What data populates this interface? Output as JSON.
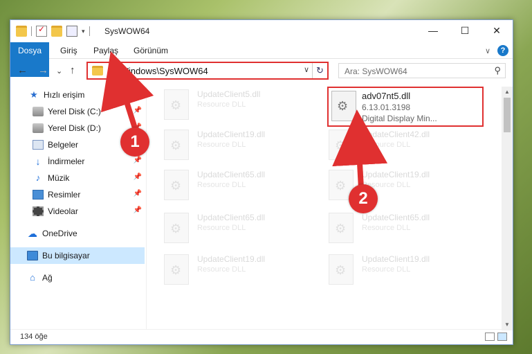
{
  "window": {
    "title": "SysWOW64",
    "controls": {
      "minimize": "—",
      "maximize": "☐",
      "close": "✕"
    }
  },
  "ribbon": {
    "tabs": [
      "Dosya",
      "Giriş",
      "Paylaş",
      "Görünüm"
    ],
    "help": "?",
    "collapse": "∨"
  },
  "nav": {
    "back": "←",
    "forward": "→",
    "recent": "⌄",
    "up": "↑",
    "address": "C:\\Windows\\SysWOW64",
    "address_dropdown": "∨",
    "refresh": "↻",
    "search_placeholder": "Ara: SysWOW64",
    "search_icon": "⚲"
  },
  "sidebar": {
    "items": [
      {
        "label": "Hızlı erişim",
        "icon": "star-icon"
      },
      {
        "label": "Yerel Disk (C:)",
        "icon": "disk-icon",
        "pinned": true
      },
      {
        "label": "Yerel Disk (D:)",
        "icon": "disk-icon",
        "pinned": true
      },
      {
        "label": "Belgeler",
        "icon": "documents-icon",
        "pinned": true
      },
      {
        "label": "İndirmeler",
        "icon": "download-icon",
        "pinned": true
      },
      {
        "label": "Müzik",
        "icon": "music-icon",
        "pinned": true
      },
      {
        "label": "Resimler",
        "icon": "pictures-icon",
        "pinned": true
      },
      {
        "label": "Videolar",
        "icon": "videos-icon",
        "pinned": true
      },
      {
        "label": "OneDrive",
        "icon": "onedrive-icon"
      },
      {
        "label": "Bu bilgisayar",
        "icon": "computer-icon",
        "selected": true
      },
      {
        "label": "Ağ",
        "icon": "network-icon"
      }
    ],
    "pin_glyph": "📌"
  },
  "files": {
    "left_column": [
      {
        "name": "UpdateClient5.dll",
        "type": "Resource DLL"
      },
      {
        "name": "UpdateClient19.dll",
        "type": "Resource DLL"
      },
      {
        "name": "UpdateClient65.dll",
        "type": "Resource DLL"
      },
      {
        "name": "UpdateClient65.dll",
        "type": "Resource DLL"
      },
      {
        "name": "UpdateClient19.dll",
        "type": "Resource DLL"
      }
    ],
    "right_column": [
      {
        "name": "UpdateClient42.dll",
        "type": "Resource DLL"
      },
      {
        "name": "UpdateClient19.dll",
        "type": "Resource DLL"
      },
      {
        "name": "UpdateClient65.dll",
        "type": "Resource DLL"
      },
      {
        "name": "UpdateClient19.dll",
        "type": "Resource DLL"
      }
    ],
    "highlighted": {
      "name": "adv07nt5.dll",
      "version": "6.13.01.3198",
      "description": "Digital Display Min..."
    }
  },
  "status": {
    "count": "134 öğe"
  },
  "annotations": {
    "badge1": "1",
    "badge2": "2",
    "color": "#e03030"
  }
}
